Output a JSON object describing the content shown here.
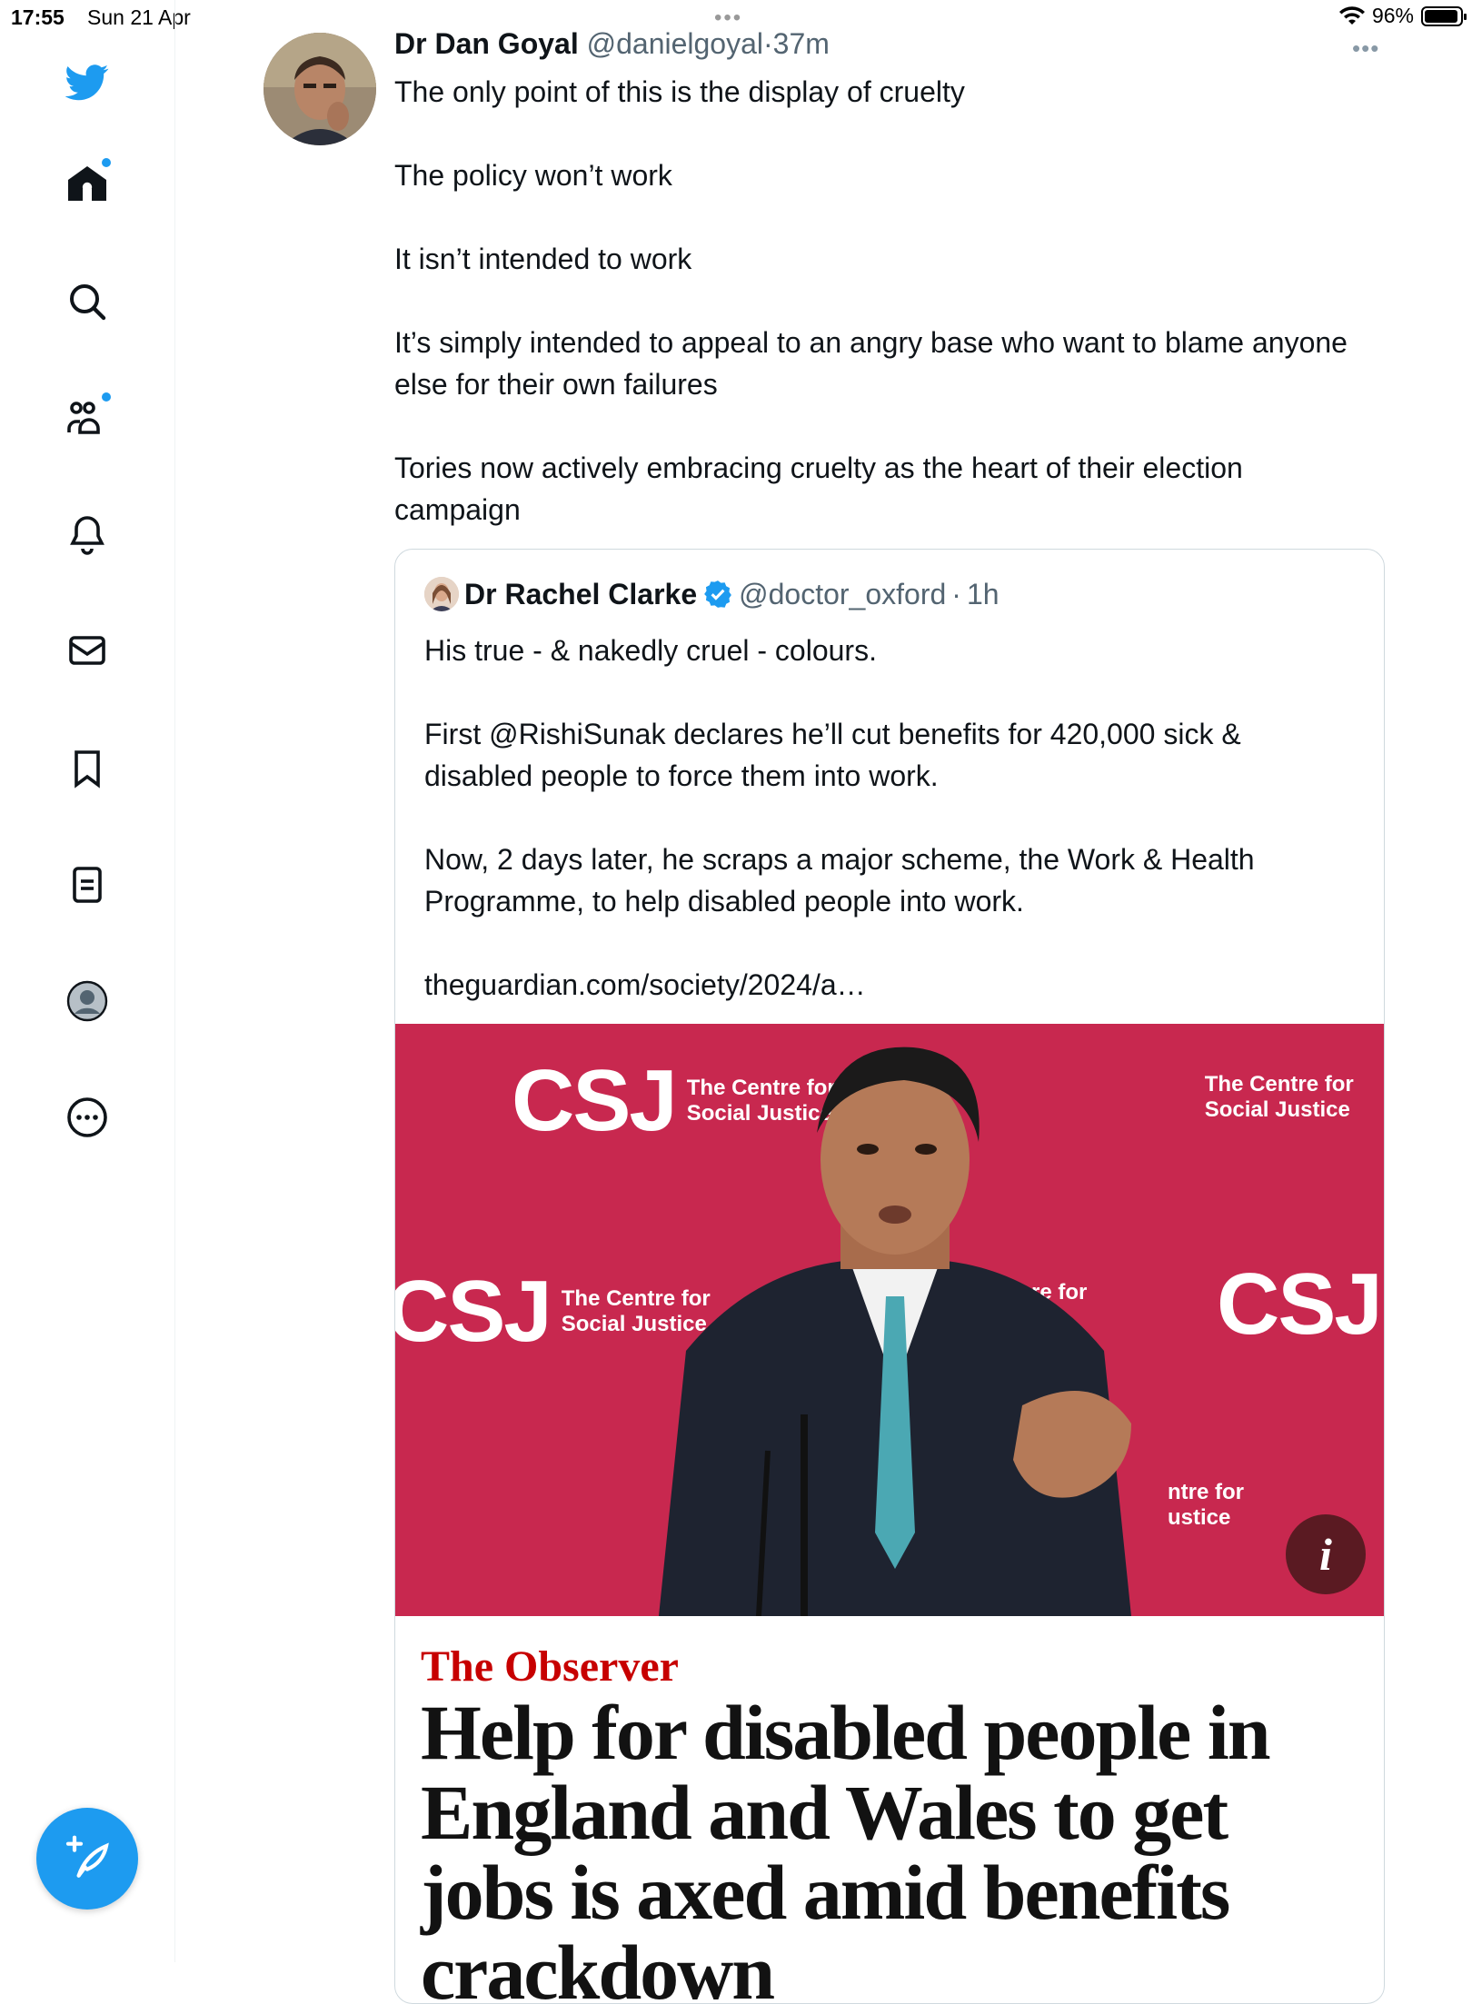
{
  "status_bar": {
    "time": "17:55",
    "date": "Sun 21 Apr",
    "battery": "96%",
    "battery_level": 0.96
  },
  "sidebar": {
    "items": [
      "home",
      "explore",
      "communities",
      "notifications",
      "messages",
      "bookmarks",
      "lists",
      "profile",
      "more"
    ],
    "compose_icon": "compose-icon"
  },
  "tweet": {
    "author_name": "Dr Dan Goyal",
    "handle": "@danielgoyal",
    "separator": "·",
    "time": "37m",
    "paragraphs": [
      "The only point of this is the display of cruelty",
      "The policy won’t work",
      "It isn’t intended to work",
      "It’s simply intended to appeal to an angry base who want to blame anyone else for their own failures",
      "Tories now actively embracing cruelty as the heart of their election campaign"
    ],
    "more_glyph": "•••"
  },
  "quote": {
    "author_name": "Dr Rachel Clarke",
    "handle": "@doctor_oxford",
    "time": "1h",
    "paragraphs": [
      "His true - & nakedly cruel - colours.",
      "First @RishiSunak declares he’ll cut benefits for 420,000 sick & disabled people to force them into work.",
      "Now, 2 days later, he scraps a major scheme, the Work & Health Programme, to help disabled people into work.",
      "theguardian.com/society/2024/a…"
    ],
    "image": {
      "logo_text": "CSJ",
      "logo_sub_1": "The Centre for",
      "logo_sub_2": "Social Justice",
      "fragment_1": "re for",
      "fragment_2": "ntre for",
      "fragment_3": "ustice",
      "info_glyph": "i"
    },
    "publication": "The Observer",
    "headline": "Help for disabled people in England and Wales to get jobs is axed amid benefits crackdown"
  },
  "colors": {
    "accent": "#1d9bf0",
    "observer_red": "#c70000",
    "image_bg": "#c8284f"
  }
}
